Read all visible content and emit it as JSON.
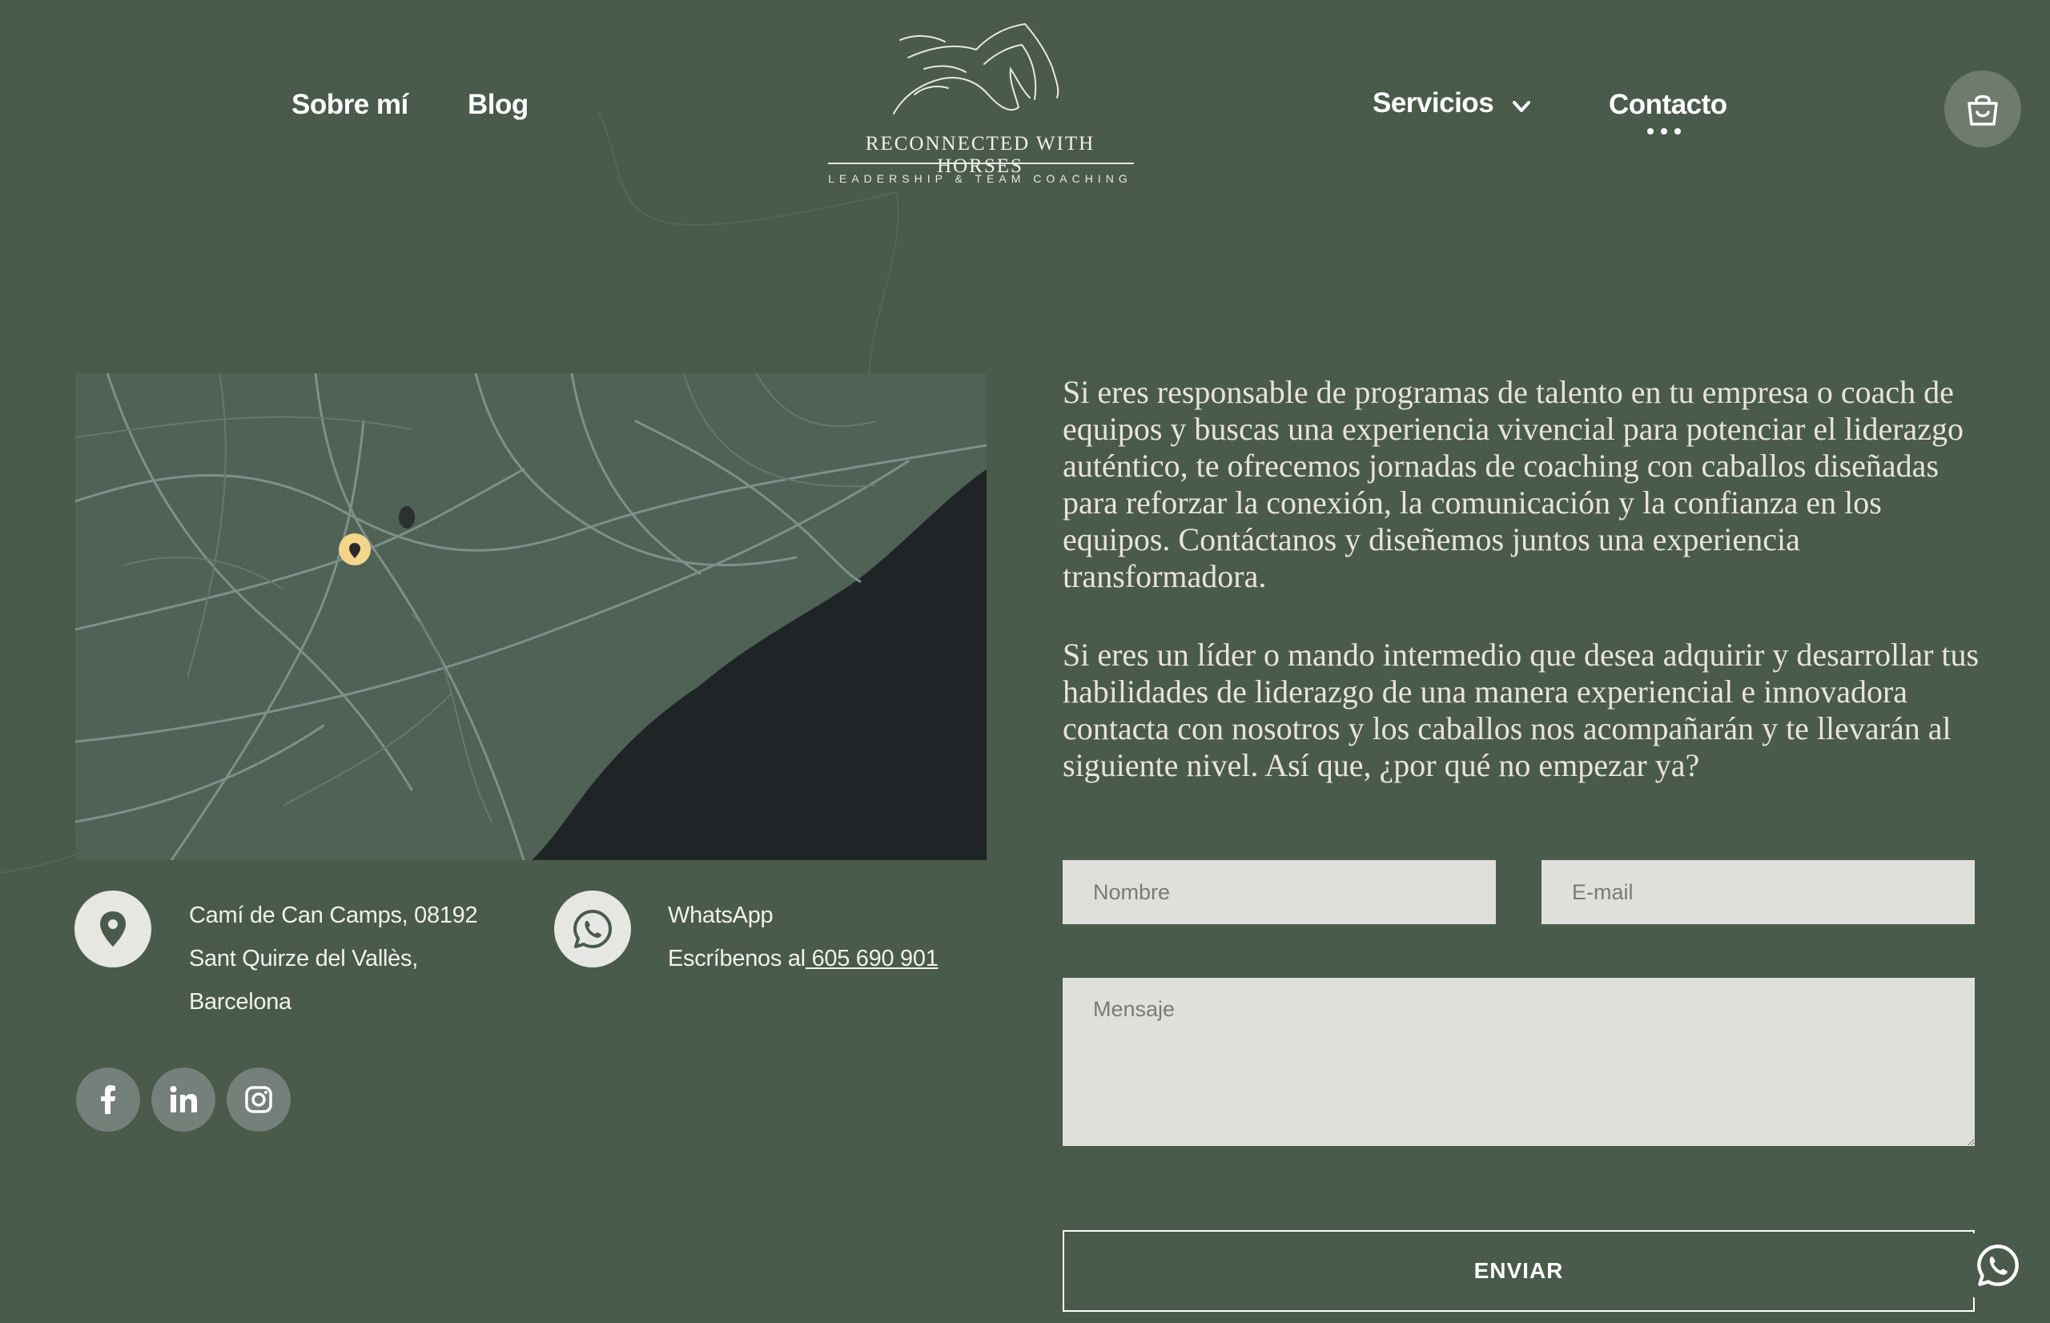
{
  "nav": {
    "sobre_label": "Sobre mí",
    "blog_label": "Blog",
    "servicios_label": "Servicios",
    "contacto_label": "Contacto"
  },
  "logo": {
    "title": "RECONNECTED WITH HORSES",
    "subtitle": "LEADERSHIP & TEAM COACHING"
  },
  "icons": {
    "cart": "shopping-bag-icon",
    "location": "map-pin-icon",
    "whatsapp": "whatsapp-icon",
    "facebook": "facebook-icon",
    "linkedin": "linkedin-icon",
    "instagram": "instagram-icon"
  },
  "contact": {
    "address_line1": "Camí de Can Camps, 08192",
    "address_line2": "Sant Quirze del Vallès,",
    "address_line3": "Barcelona",
    "whatsapp_label": "WhatsApp",
    "whatsapp_prefix": "Escríbenos al",
    "whatsapp_number": " 605 690 901"
  },
  "intro": {
    "paragraph1": "Si eres responsable de programas de talento en tu empresa o coach de equipos y buscas una experiencia vivencial para potenciar el liderazgo auténtico, te ofrecemos jornadas de coaching con caballos diseñadas para reforzar la conexión, la comunicación y la confianza en los equipos. Contáctanos y diseñemos juntos una experiencia transformadora.",
    "paragraph2": "Si eres un líder o mando intermedio que desea adquirir y desarrollar tus habilidades de liderazgo de una manera experiencial e innovadora contacta con nosotros y los caballos nos acompañarán y te llevarán al siguiente nivel. Así que, ¿por qué no empezar ya?"
  },
  "form": {
    "name_placeholder": "Nombre",
    "email_placeholder": "E-mail",
    "message_placeholder": "Mensaje",
    "submit_label": "ENVIAR"
  },
  "colors": {
    "background": "#4a5a4b",
    "map_land": "#4f6255",
    "map_sea": "#1f2427",
    "map_marker": "#f5d58a",
    "field_bg": "#dfe0dc"
  }
}
